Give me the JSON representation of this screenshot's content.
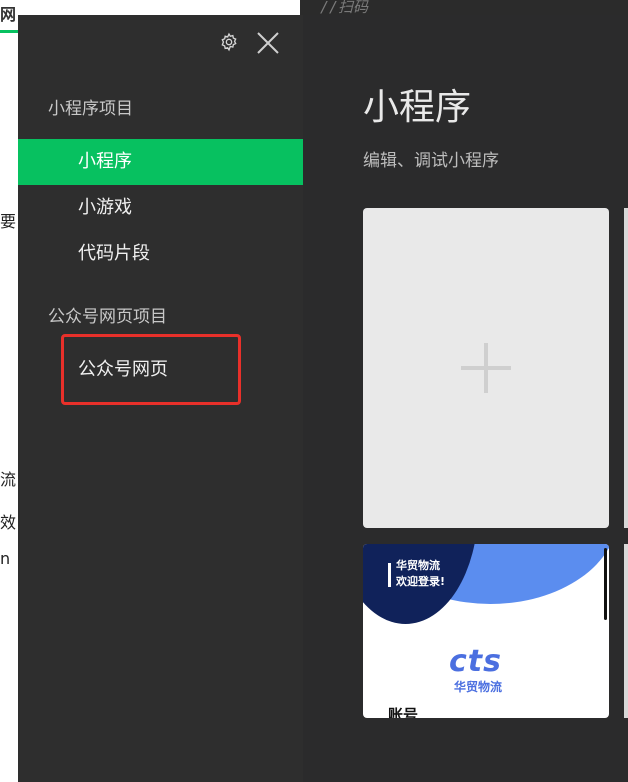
{
  "background": {
    "left_tab": "网",
    "code_comment": "//扫码",
    "fragments": [
      "要",
      "流",
      "效",
      "n"
    ]
  },
  "sidebar": {
    "sections": [
      {
        "title": "小程序项目",
        "items": [
          {
            "label": "小程序",
            "active": true
          },
          {
            "label": "小游戏",
            "active": false
          },
          {
            "label": "代码片段",
            "active": false
          }
        ]
      },
      {
        "title": "公众号网页项目",
        "items": [
          {
            "label": "公众号网页",
            "active": false,
            "highlighted": true
          }
        ]
      }
    ],
    "icons": [
      "gear-icon",
      "close-icon"
    ]
  },
  "main": {
    "title": "小程序",
    "subtitle": "编辑、调试小程序",
    "new_project_icon": "plus-icon",
    "project_thumb": {
      "title_line1": "华贸物流",
      "title_line2": "欢迎登录!",
      "logo": "cts",
      "logo_sub": "华贸物流",
      "cut_text": "账号"
    }
  },
  "colors": {
    "accent": "#07c160",
    "sidebar_bg": "#2e2e2e",
    "main_bg": "#2b2b2c",
    "highlight_border": "#e8302a",
    "logo_blue": "#4b6fe0",
    "thumb_navy": "#10225a"
  }
}
